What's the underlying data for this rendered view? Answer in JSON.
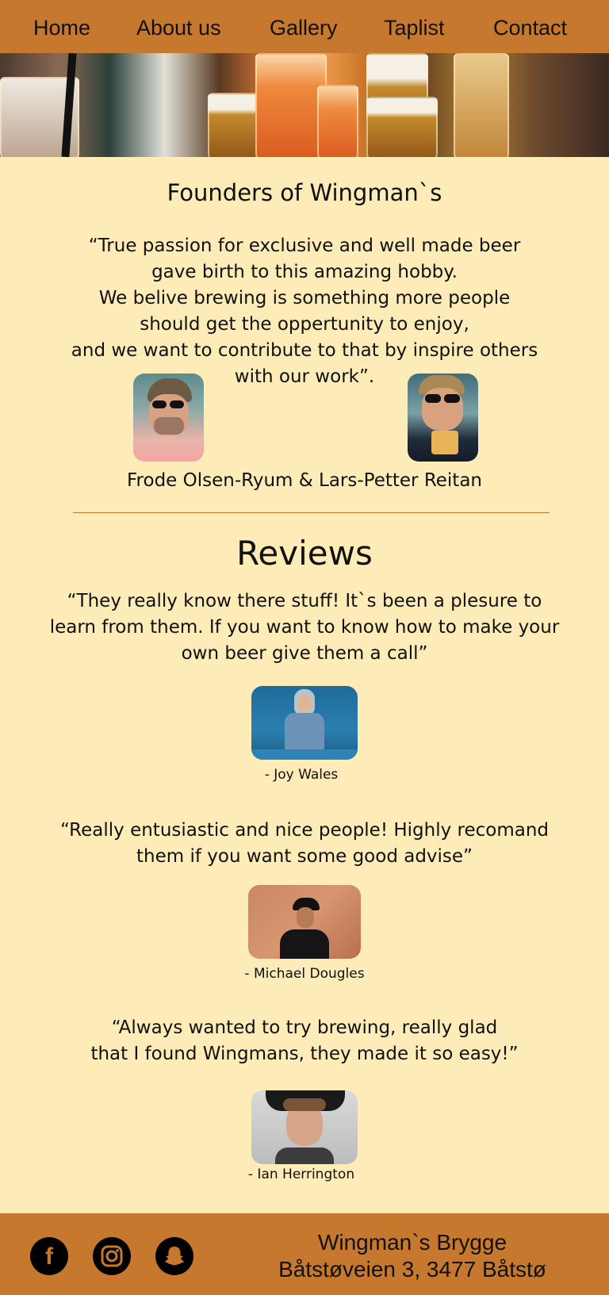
{
  "nav": {
    "items": [
      {
        "label": "Home"
      },
      {
        "label": "About us"
      },
      {
        "label": "Gallery"
      },
      {
        "label": "Taplist"
      },
      {
        "label": "Contact"
      }
    ]
  },
  "founders": {
    "title": "Founders of Wingman`s",
    "quote_lines": [
      "“True passion for exclusive and well made beer",
      "gave birth to this amazing hobby.",
      "We belive brewing is something more people",
      "should get the oppertunity to enjoy,",
      "and we want to contribute to that by inspire others",
      "with our work”."
    ],
    "names": "Frode Olsen-Ryum & Lars-Petter Reitan"
  },
  "reviews": {
    "title": "Reviews",
    "items": [
      {
        "lines": [
          "“They really know there stuff! It`s been a plesure to",
          "learn from them. If you want to know how to make your",
          "own beer give them a call”"
        ],
        "author": "- Joy Wales"
      },
      {
        "lines": [
          "“Really entusiastic and nice people! Highly recomand",
          "them if you want some good advise”"
        ],
        "author": "- Michael Dougles"
      },
      {
        "lines": [
          "“Always wanted to try brewing, really glad",
          "that I found Wingmans, they made it so easy!”"
        ],
        "author": "- Ian Herrington"
      }
    ]
  },
  "footer": {
    "social_icons": [
      "facebook-icon",
      "instagram-icon",
      "snapchat-icon"
    ],
    "name": "Wingman`s Brygge",
    "address": "Båtstøveien 3, 3477 Båtstø"
  },
  "colors": {
    "header_footer": "#c6792e",
    "background": "#fdebb8"
  }
}
